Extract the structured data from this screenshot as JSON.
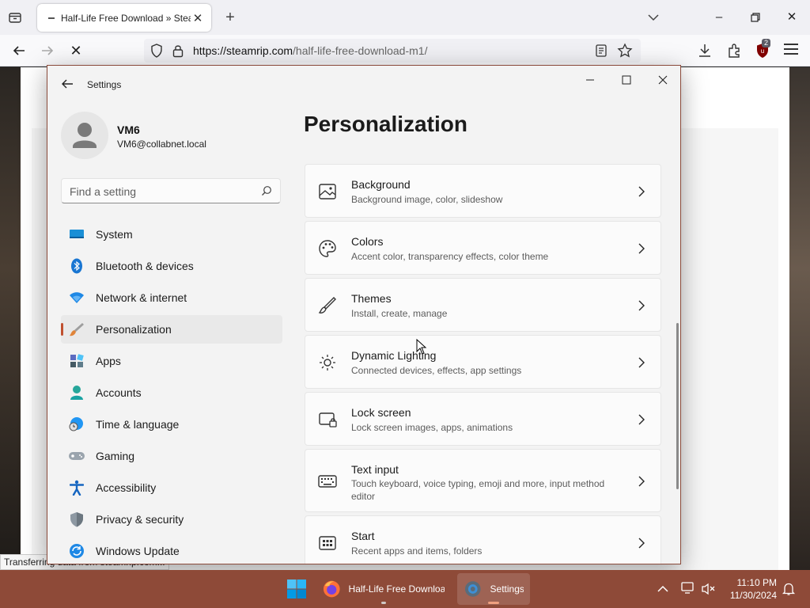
{
  "browser": {
    "tab_title": "Half-Life Free Download » Steam",
    "url_host": "https://steamrip.com",
    "url_path": "/half-life-free-download-m1/",
    "ublock_badge": "2",
    "status_text": "Transferring data from steamrip.com..."
  },
  "settings": {
    "app_title": "Settings",
    "user_name": "VM6",
    "user_email": "VM6@collabnet.local",
    "search_placeholder": "Find a setting",
    "page_heading": "Personalization",
    "nav": [
      {
        "label": "System",
        "icon": "system-icon"
      },
      {
        "label": "Bluetooth & devices",
        "icon": "bluetooth-icon"
      },
      {
        "label": "Network & internet",
        "icon": "wifi-icon"
      },
      {
        "label": "Personalization",
        "icon": "brush-icon",
        "active": true
      },
      {
        "label": "Apps",
        "icon": "apps-icon"
      },
      {
        "label": "Accounts",
        "icon": "accounts-icon"
      },
      {
        "label": "Time & language",
        "icon": "clock-globe-icon"
      },
      {
        "label": "Gaming",
        "icon": "gamepad-icon"
      },
      {
        "label": "Accessibility",
        "icon": "accessibility-icon"
      },
      {
        "label": "Privacy & security",
        "icon": "shield-icon"
      },
      {
        "label": "Windows Update",
        "icon": "update-icon"
      }
    ],
    "cards": [
      {
        "title": "Background",
        "subtitle": "Background image, color, slideshow",
        "icon": "image-icon"
      },
      {
        "title": "Colors",
        "subtitle": "Accent color, transparency effects, color theme",
        "icon": "palette-icon"
      },
      {
        "title": "Themes",
        "subtitle": "Install, create, manage",
        "icon": "brush-icon"
      },
      {
        "title": "Dynamic Lighting",
        "subtitle": "Connected devices, effects, app settings",
        "icon": "lighting-icon"
      },
      {
        "title": "Lock screen",
        "subtitle": "Lock screen images, apps, animations",
        "icon": "lock-screen-icon"
      },
      {
        "title": "Text input",
        "subtitle": "Touch keyboard, voice typing, emoji and more, input method editor",
        "icon": "keyboard-icon"
      },
      {
        "title": "Start",
        "subtitle": "Recent apps and items, folders",
        "icon": "start-icon"
      }
    ]
  },
  "taskbar": {
    "firefox_label": "Half-Life Free Download",
    "settings_label": "Settings",
    "time": "11:10 PM",
    "date": "11/30/2024"
  },
  "colors": {
    "taskbar": "#8e4a38",
    "accent": "#c0502f",
    "settings_bg": "#f3f3f3"
  }
}
